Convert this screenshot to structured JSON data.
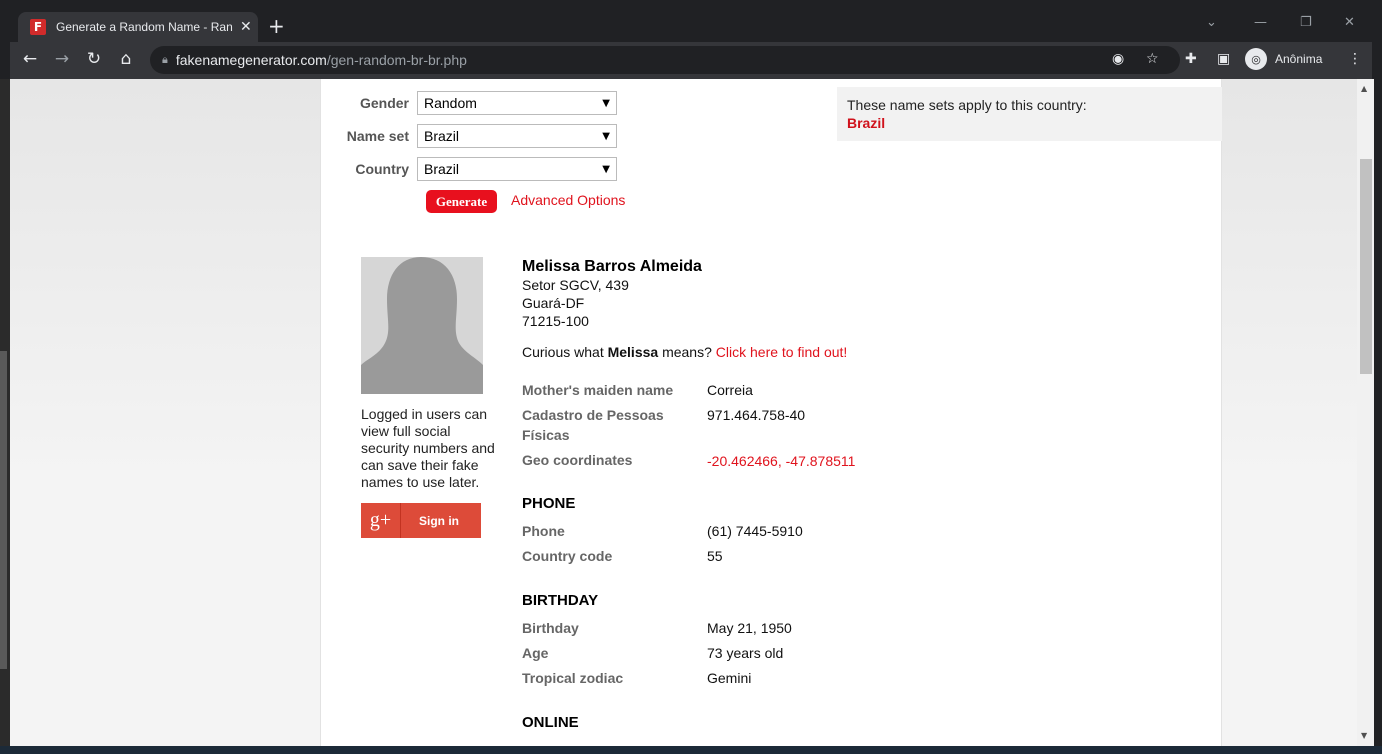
{
  "browser": {
    "tab_title": "Generate a Random Name - Ran",
    "favicon_letter": "F",
    "url_host": "fakenamegenerator.com",
    "url_path": "/gen-random-br-br.php",
    "profile_label": "Anônima"
  },
  "form": {
    "gender_label": "Gender",
    "gender_value": "Random",
    "nameset_label": "Name set",
    "nameset_value": "Brazil",
    "country_label": "Country",
    "country_value": "Brazil",
    "generate_label": "Generate",
    "advanced_label": "Advanced Options"
  },
  "notice": {
    "text": "These name sets apply to this country:",
    "country": "Brazil"
  },
  "sidebar": {
    "login_note": "Logged in users can view full social security numbers and can save their fake names to use later.",
    "gplus_icon": "g+",
    "signin_label": "Sign in"
  },
  "identity": {
    "name": "Melissa Barros Almeida",
    "address_line1": "Setor SGCV, 439",
    "address_line2": "Guará-DF",
    "address_line3": "71215-100",
    "curious_prefix": "Curious what ",
    "curious_name": "Melissa",
    "curious_middle": " means? ",
    "curious_link": "Click here to find out!",
    "mothers_maiden_label": "Mother's maiden name",
    "mothers_maiden_value": "Correia",
    "cpf_label": "Cadastro de Pessoas Físicas",
    "cpf_value": "971.464.758-40",
    "geo_label": "Geo coordinates",
    "geo_value": "-20.462466, -47.878511"
  },
  "phone": {
    "heading": "PHONE",
    "phone_label": "Phone",
    "phone_value": "(61) 7445-5910",
    "cc_label": "Country code",
    "cc_value": "55"
  },
  "birthday": {
    "heading": "BIRTHDAY",
    "birthday_label": "Birthday",
    "birthday_value": "May 21, 1950",
    "age_label": "Age",
    "age_value": "73 years old",
    "zodiac_label": "Tropical zodiac",
    "zodiac_value": "Gemini"
  },
  "online": {
    "heading": "ONLINE"
  }
}
